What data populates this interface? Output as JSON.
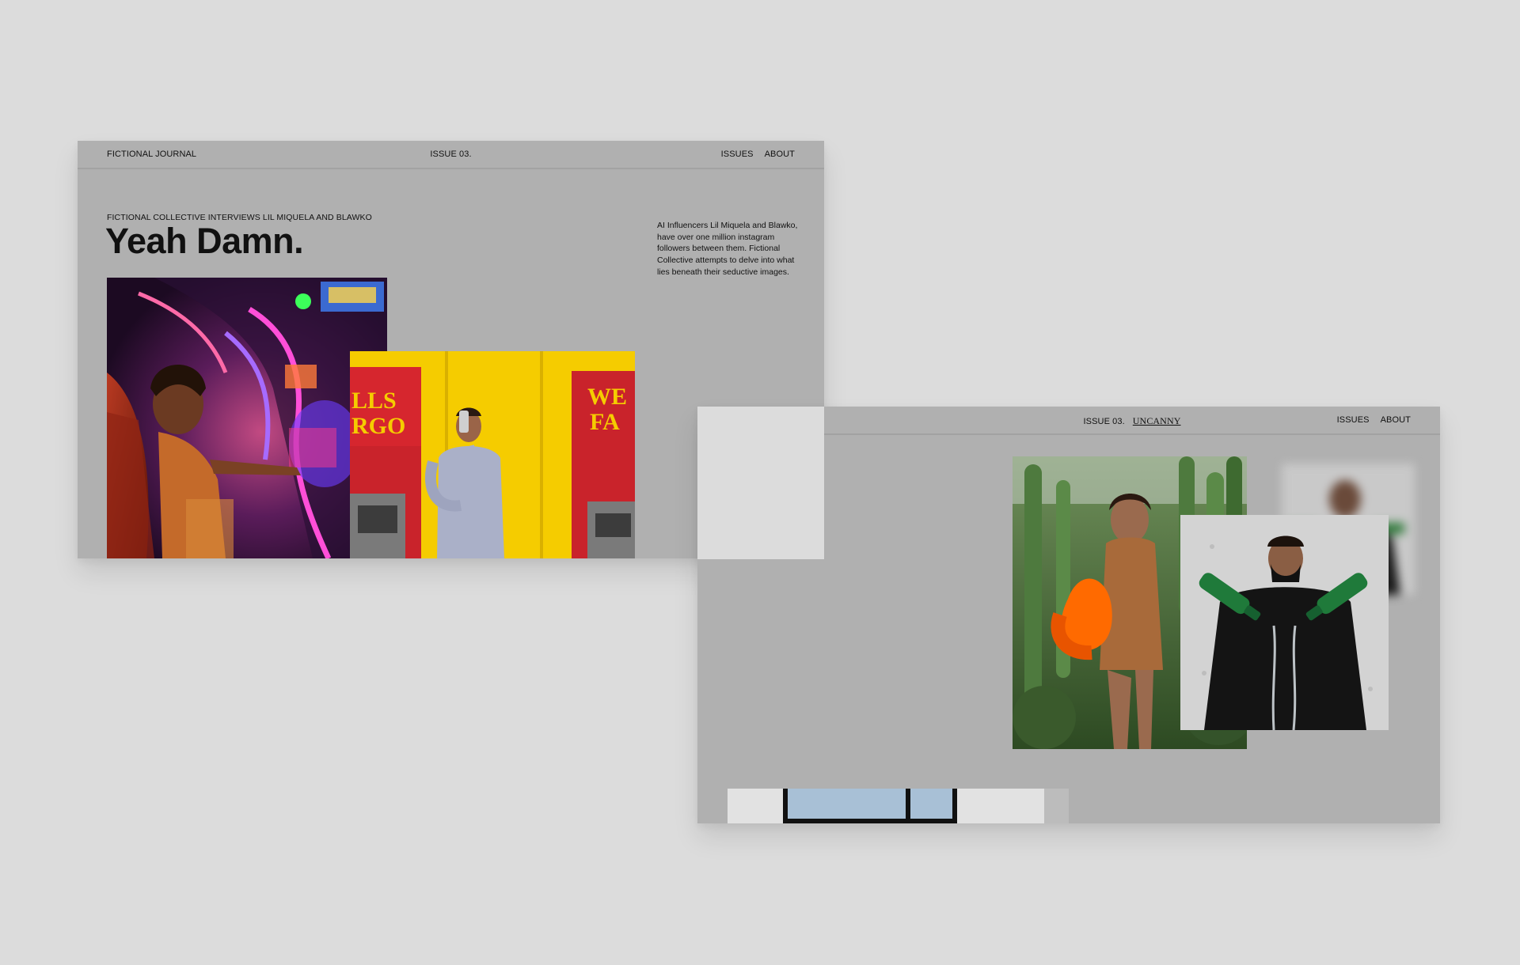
{
  "frame_1": {
    "nav": {
      "brand": "FICTIONAL JOURNAL",
      "issue": "ISSUE 03.",
      "links": [
        "ISSUES",
        "ABOUT"
      ]
    },
    "kicker": "FICTIONAL COLLECTIVE INTERVIEWS LIL MIQUELA AND BLAWKO",
    "headline": "Yeah Damn.",
    "intro": "AI Influencers Lil Miquela and Blawko, have over one million instagram followers between them. Fictional Collective attempts to delve into what lies beneath their seductive images.",
    "photo_text": {
      "sign_left_1": "LLS",
      "sign_left_2": "RGO",
      "sign_right_1": "WE",
      "sign_right_2": "FA"
    }
  },
  "frame_2": {
    "nav": {
      "issue": "ISSUE 03.",
      "title": "UNCANNY",
      "links": [
        "ISSUES",
        "ABOUT"
      ]
    }
  },
  "colors": {
    "page_background": "#dcdcdc",
    "frame_background": "#b0b0b0",
    "text": "#111111"
  }
}
